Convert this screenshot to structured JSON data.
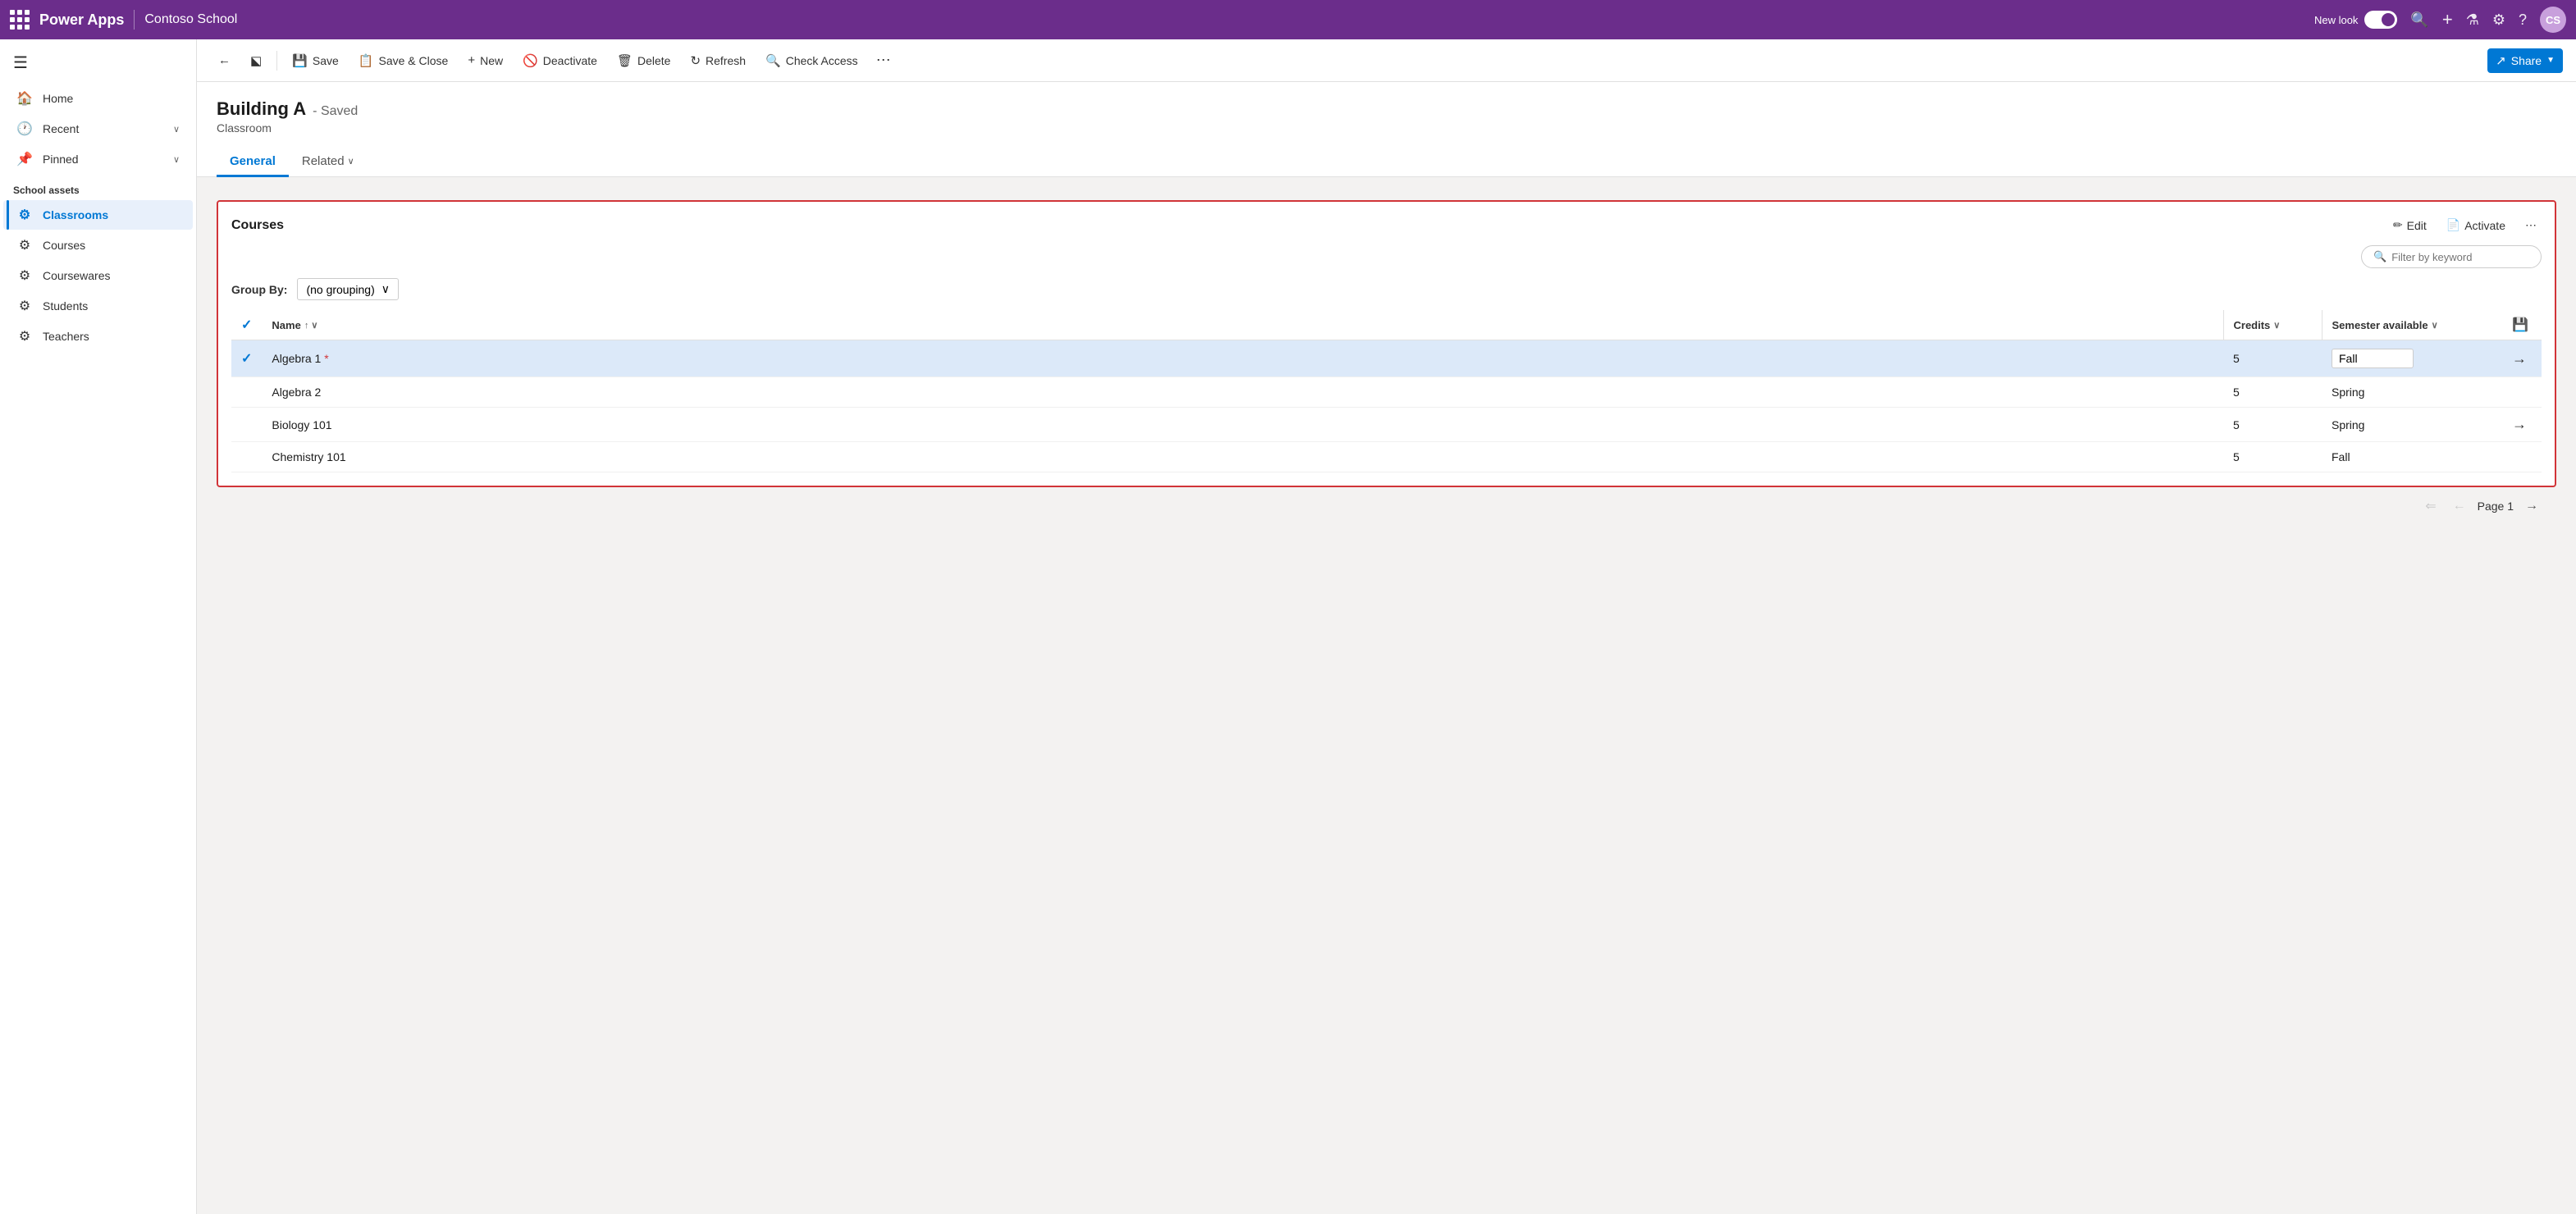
{
  "topNav": {
    "waffle_label": "Apps menu",
    "brand": "Power Apps",
    "divider": true,
    "app_name": "Contoso School",
    "new_look_label": "New look",
    "icons": {
      "search": "🔍",
      "add": "+",
      "filter": "⚗",
      "settings": "⚙",
      "help": "?",
      "avatar_initials": "CS"
    }
  },
  "sidebar": {
    "hamburger": "☰",
    "nav_items": [
      {
        "id": "home",
        "icon": "🏠",
        "label": "Home",
        "has_chevron": false
      },
      {
        "id": "recent",
        "icon": "🕐",
        "label": "Recent",
        "has_chevron": true
      },
      {
        "id": "pinned",
        "icon": "📌",
        "label": "Pinned",
        "has_chevron": true
      }
    ],
    "section_header": "School assets",
    "school_items": [
      {
        "id": "classrooms",
        "icon": "⚙",
        "label": "Classrooms",
        "active": true
      },
      {
        "id": "courses",
        "icon": "⚙",
        "label": "Courses",
        "active": false
      },
      {
        "id": "coursewares",
        "icon": "⚙",
        "label": "Coursewares",
        "active": false
      },
      {
        "id": "students",
        "icon": "⚙",
        "label": "Students",
        "active": false
      },
      {
        "id": "teachers",
        "icon": "⚙",
        "label": "Teachers",
        "active": false
      }
    ]
  },
  "toolbar": {
    "back_label": "←",
    "open_label": "⬕",
    "save_label": "Save",
    "save_close_label": "Save & Close",
    "new_label": "New",
    "deactivate_label": "Deactivate",
    "delete_label": "Delete",
    "refresh_label": "Refresh",
    "check_access_label": "Check Access",
    "more_label": "⋯",
    "share_label": "Share"
  },
  "record": {
    "title": "Building A",
    "saved_status": "- Saved",
    "subtitle": "Classroom",
    "tabs": [
      {
        "id": "general",
        "label": "General",
        "active": true
      },
      {
        "id": "related",
        "label": "Related",
        "active": false,
        "has_chevron": true
      }
    ]
  },
  "courses_section": {
    "title": "Courses",
    "edit_label": "Edit",
    "activate_label": "Activate",
    "more_label": "⋯",
    "filter_placeholder": "Filter by keyword",
    "group_by_label": "Group By:",
    "group_by_value": "(no grouping)",
    "columns": [
      {
        "id": "name",
        "label": "Name",
        "sortable": true,
        "sort_dir": "asc"
      },
      {
        "id": "credits",
        "label": "Credits",
        "sortable": true
      },
      {
        "id": "semester",
        "label": "Semester available",
        "sortable": true
      }
    ],
    "rows": [
      {
        "id": 1,
        "name": "Algebra 1",
        "credits": 5,
        "semester": "Fall",
        "selected": true,
        "has_arrow": true,
        "has_star": true
      },
      {
        "id": 2,
        "name": "Algebra 2",
        "credits": 5,
        "semester": "Spring",
        "selected": false,
        "has_arrow": false,
        "has_star": false
      },
      {
        "id": 3,
        "name": "Biology 101",
        "credits": 5,
        "semester": "Spring",
        "selected": false,
        "has_arrow": true,
        "has_star": false
      },
      {
        "id": 4,
        "name": "Chemistry 101",
        "credits": 5,
        "semester": "Fall",
        "selected": false,
        "has_arrow": false,
        "has_star": false
      }
    ],
    "pagination": {
      "page_label": "Page 1",
      "first_disabled": true,
      "prev_disabled": true,
      "next_disabled": false
    }
  }
}
